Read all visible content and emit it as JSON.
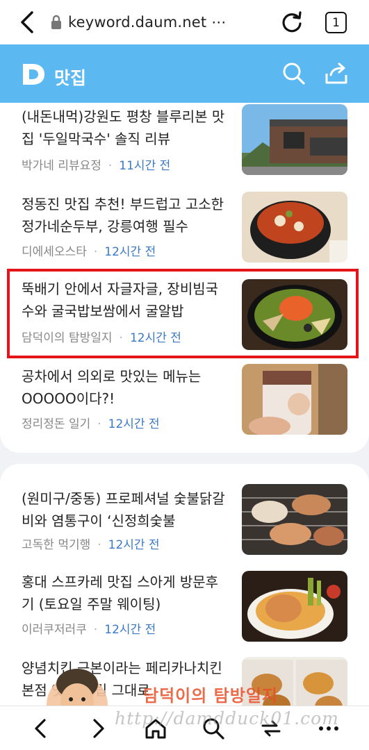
{
  "browser": {
    "url": "keyword.daum.net ⋯",
    "tab_count": "1"
  },
  "header": {
    "title": "맛집"
  },
  "articles": [
    {
      "title": "(내돈내먹)강원도 평창 블루리본 맛집 '두일막국수' 솔직 리뷰",
      "source": "박가네 리뷰요정",
      "time": "11시간 전"
    },
    {
      "title": "정동진 맛집 추천! 부드럽고 고소한 정가네순두부, 강릉여행 필수",
      "source": "디에세오스타",
      "time": "12시간 전"
    },
    {
      "title": "뚝배기 안에서 자글자글, 장비빔국수와 굴국밥보쌈에서 굴알밥",
      "source": "담덕이의 탐방일지",
      "time": "12시간 전"
    },
    {
      "title": "공차에서 의외로 맛있는 메뉴는 OOOOO이다?!",
      "source": "정리정돈 일기",
      "time": "12시간 전"
    },
    {
      "title": "(원미구/중동) 프로페셔널 숯불닭갈비와 염통구이 ‘신정희숯불",
      "source": "고독한 먹기행",
      "time": "12시간 전"
    },
    {
      "title": "홍대 스프카레 맛집 스아게 방문후기 (토요일 주말 웨이팅)",
      "source": "이러쿠저러쿠",
      "time": "12시간 전"
    },
    {
      "title": "양념치킨 근본이라는 페리카나치킨 본점 옛날 노립 그대로",
      "source": "",
      "time": ""
    }
  ],
  "watermark": {
    "url": "http://damdduck01.com",
    "name": "담덕이의 탐방일지"
  },
  "colors": {
    "header_bg": "#5cb8f0",
    "time_text": "#3a78c8",
    "highlight": "#e3151a"
  }
}
